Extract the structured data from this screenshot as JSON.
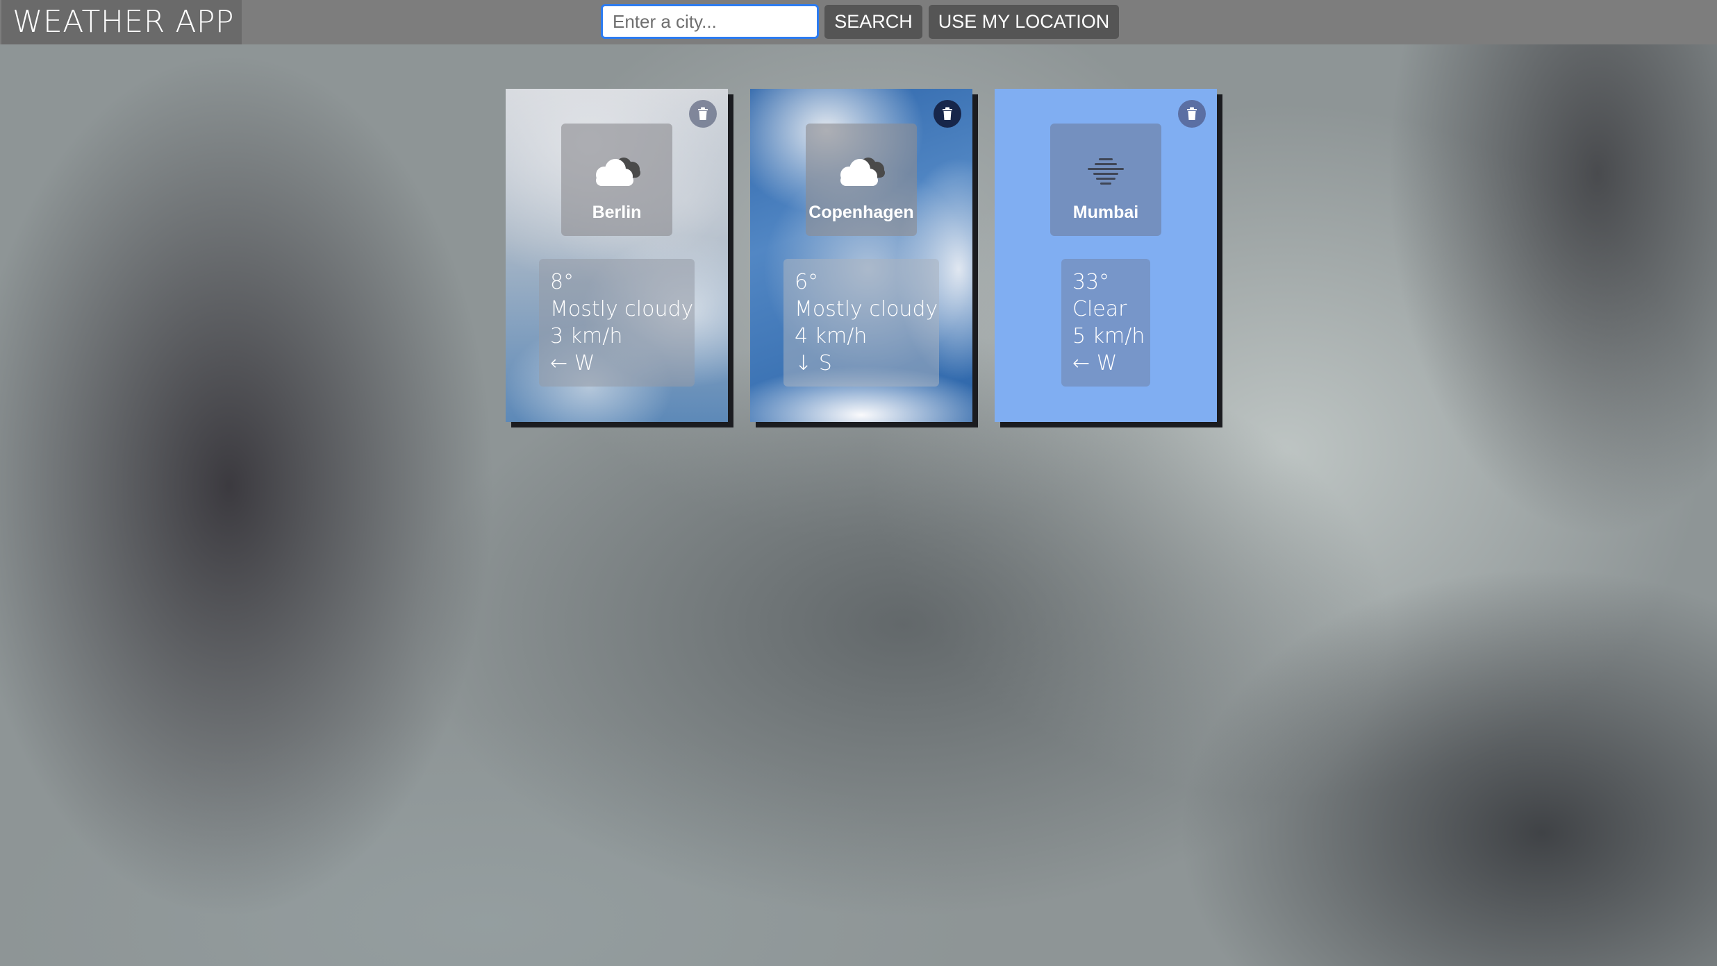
{
  "header": {
    "title": "WEATHER APP",
    "search_placeholder": "Enter a city...",
    "search_value": "",
    "search_button": "SEARCH",
    "location_button": "USE MY LOCATION"
  },
  "cards": [
    {
      "city": "Berlin",
      "icon": "cloudy-icon",
      "temperature": "8°",
      "condition": "Mostly cloudy",
      "wind_speed": "3 km/h",
      "wind_arrow": "←",
      "wind_direction": "W",
      "background": "sky-photo"
    },
    {
      "city": "Copenhagen",
      "icon": "cloudy-icon",
      "temperature": "6°",
      "condition": "Mostly cloudy",
      "wind_speed": "4 km/h",
      "wind_arrow": "↓",
      "wind_direction": "S",
      "background": "sky-photo"
    },
    {
      "city": "Mumbai",
      "icon": "haze-icon",
      "temperature": "33°",
      "condition": "Clear",
      "wind_speed": "5 km/h",
      "wind_arrow": "←",
      "wind_direction": "W",
      "background": "#80aef2"
    }
  ],
  "colors": {
    "header_bar": "#7d7d7d",
    "brand_bg": "#6a6a6a",
    "button_bg": "#555555",
    "input_focus_border": "#2d7cf0",
    "card_shadow": "#1b1c20",
    "mumbai_card": "#80aef2"
  }
}
